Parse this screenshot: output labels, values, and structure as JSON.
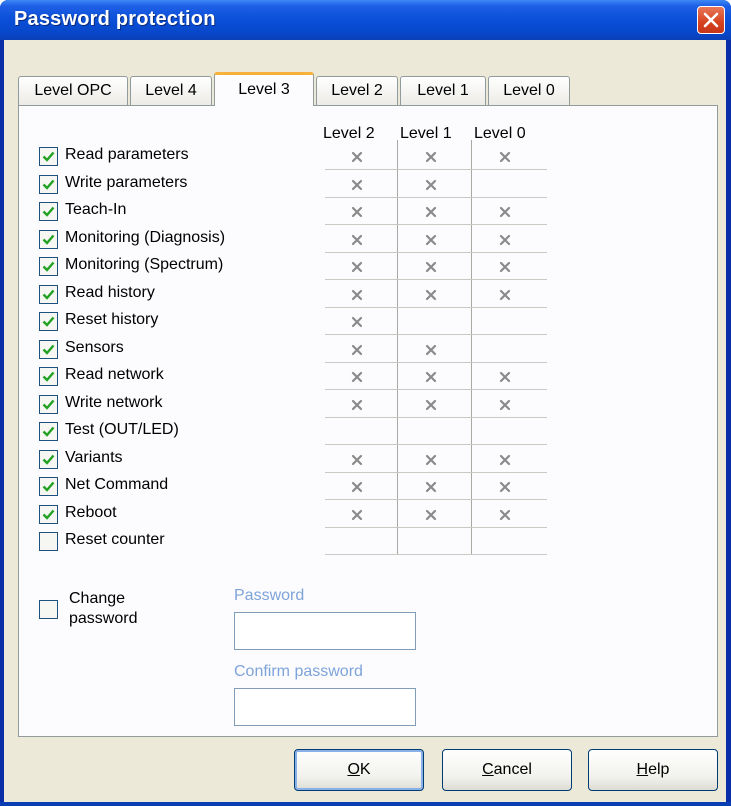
{
  "window": {
    "title": "Password protection",
    "close_icon": "close-icon"
  },
  "tabs": [
    {
      "label": "Level OPC"
    },
    {
      "label": "Level 4"
    },
    {
      "label": "Level 3",
      "active": true
    },
    {
      "label": "Level 2"
    },
    {
      "label": "Level 1"
    },
    {
      "label": "Level 0"
    }
  ],
  "columns": [
    "Level 2",
    "Level 1",
    "Level 0"
  ],
  "permissions": [
    {
      "label": "Read parameters",
      "checked": true,
      "marks": [
        true,
        true,
        true
      ]
    },
    {
      "label": "Write parameters",
      "checked": true,
      "marks": [
        true,
        true,
        false
      ]
    },
    {
      "label": "Teach-In",
      "checked": true,
      "marks": [
        true,
        true,
        true
      ]
    },
    {
      "label": "Monitoring (Diagnosis)",
      "checked": true,
      "marks": [
        true,
        true,
        true
      ]
    },
    {
      "label": "Monitoring (Spectrum)",
      "checked": true,
      "marks": [
        true,
        true,
        true
      ]
    },
    {
      "label": "Read history",
      "checked": true,
      "marks": [
        true,
        true,
        true
      ]
    },
    {
      "label": "Reset history",
      "checked": true,
      "marks": [
        true,
        false,
        false
      ]
    },
    {
      "label": "Sensors",
      "checked": true,
      "marks": [
        true,
        true,
        false
      ]
    },
    {
      "label": "Read network",
      "checked": true,
      "marks": [
        true,
        true,
        true
      ]
    },
    {
      "label": "Write network",
      "checked": true,
      "marks": [
        true,
        true,
        true
      ]
    },
    {
      "label": "Test (OUT/LED)",
      "checked": true,
      "marks": [
        false,
        false,
        false
      ]
    },
    {
      "label": "Variants",
      "checked": true,
      "marks": [
        true,
        true,
        true
      ]
    },
    {
      "label": "Net Command",
      "checked": true,
      "marks": [
        true,
        true,
        true
      ]
    },
    {
      "label": "Reboot",
      "checked": true,
      "marks": [
        true,
        true,
        true
      ]
    },
    {
      "label": "Reset counter",
      "checked": false,
      "marks": [
        false,
        false,
        false
      ]
    }
  ],
  "change_password": {
    "label_line1": "Change",
    "label_line2": "password",
    "checked": false
  },
  "password": {
    "label": "Password",
    "value": ""
  },
  "confirm_password": {
    "label": "Confirm password",
    "value": ""
  },
  "buttons": {
    "ok": "OK",
    "cancel": "Cancel",
    "help": "Help"
  },
  "colors": {
    "title_bar": "#0a4fd8",
    "tab_accent": "#f7b13a",
    "checkbox_tick": "#21a121",
    "mark": "#8a8a8a"
  }
}
